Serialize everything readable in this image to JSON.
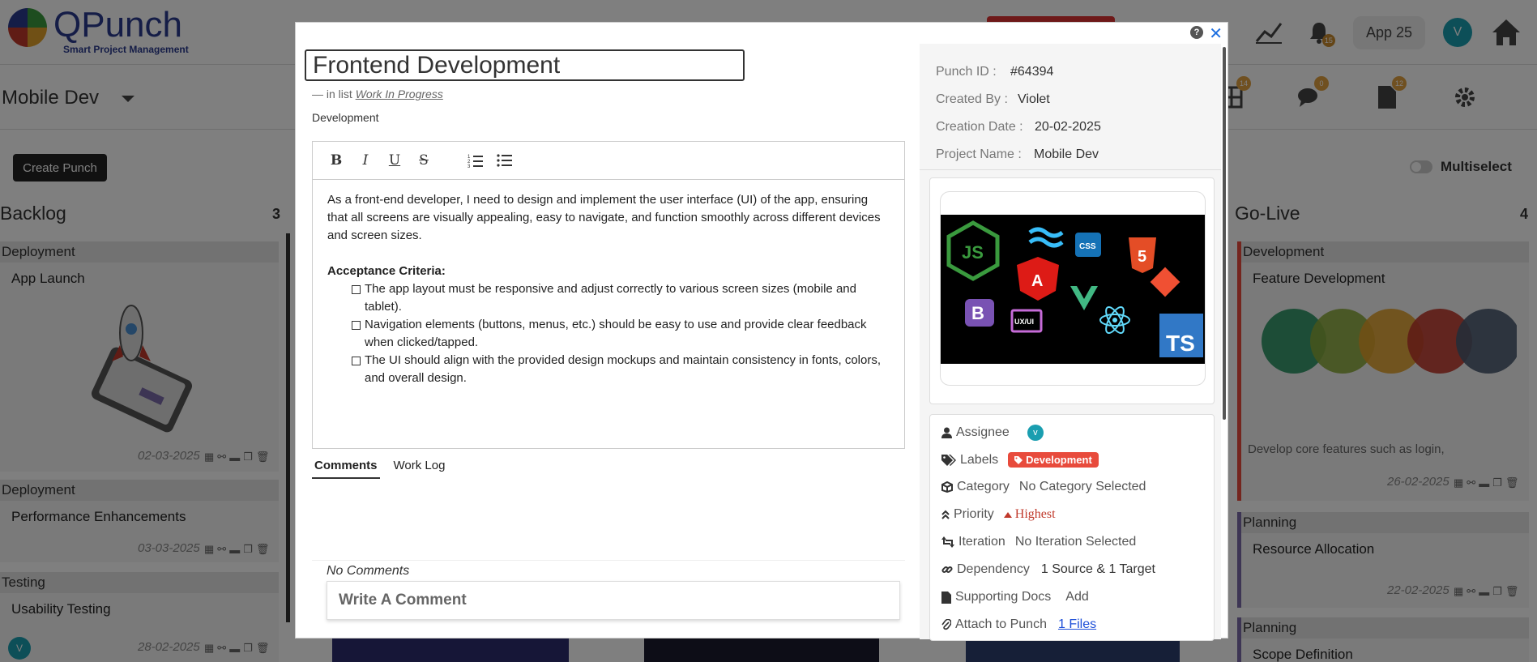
{
  "app": {
    "logo_text": "QPunch",
    "logo_sub": "Smart Project Management",
    "app_pill": "App 25",
    "avatar_initial": "V",
    "notif_count": "15"
  },
  "subbar": {
    "project_name": "Mobile Dev",
    "badges": [
      "14",
      "0",
      "12"
    ],
    "create_button": "Create Punch",
    "multiselect_label": "Multiselect"
  },
  "board": {
    "backlog": {
      "title": "Backlog",
      "count": "3",
      "cards": [
        {
          "group": "Deployment",
          "title": "App Launch",
          "date": "02-03-2025"
        },
        {
          "group": "Deployment",
          "title": "Performance Enhancements",
          "date": "03-03-2025"
        },
        {
          "group": "Testing",
          "title": "Usability Testing",
          "date": "28-02-2025",
          "avatar": "V"
        }
      ]
    },
    "golive": {
      "title": "Go-Live",
      "count": "4",
      "cards": [
        {
          "group": "Development",
          "title": "Feature Development",
          "snippet": "Develop core features such as login,",
          "date": "26-02-2025"
        },
        {
          "group": "Planning",
          "title": "Resource Allocation",
          "date": "22-02-2025"
        },
        {
          "group": "Planning",
          "title": "Scope Definition"
        }
      ]
    }
  },
  "modal": {
    "title": "Frontend Development",
    "in_list_prefix": "— in list",
    "in_list_name": "Work In Progress",
    "label_text": "Development",
    "help": "?",
    "close": "✕",
    "toolbar": {
      "bold": "B",
      "italic": "I",
      "underline": "U",
      "strike": "S",
      "ordered": "ordered-list-icon",
      "bullet": "bullet-list-icon"
    },
    "description": "As a front-end developer, I need to design and implement the user interface (UI) of the app, ensuring that all screens are visually appealing, easy to navigate, and function smoothly across different devices and screen sizes.",
    "acceptance_title": "Acceptance Criteria:",
    "acceptance": [
      "The app layout must be responsive and adjust correctly to various screen sizes (mobile and tablet).",
      "Navigation elements (buttons, menus, etc.) should be easy to use and provide clear feedback when clicked/tapped.",
      "The UI should align with the provided design mockups and maintain consistency in fonts, colors, and overall design."
    ],
    "tabs": [
      "Comments",
      "Work Log"
    ],
    "no_comments": "No Comments",
    "comment_placeholder": "Write A Comment"
  },
  "meta": {
    "punch_id_label": "Punch ID :",
    "punch_id": "#64394",
    "created_by_label": "Created By :",
    "created_by": "Violet",
    "creation_date_label": "Creation Date :",
    "creation_date": "20-02-2025",
    "project_name_label": "Project Name :",
    "project_name": "Mobile Dev"
  },
  "props": {
    "assignee_label": "Assignee",
    "assignee_initial": "v",
    "labels_label": "Labels",
    "labels_value": "Development",
    "category_label": "Category",
    "category_value": "No Category Selected",
    "priority_label": "Priority",
    "priority_value": "Highest",
    "iteration_label": "Iteration",
    "iteration_value": "No Iteration Selected",
    "dependency_label": "Dependency",
    "dependency_value": "1 Source & 1 Target",
    "docs_label": "Supporting Docs",
    "docs_value": "Add",
    "attach_label": "Attach to Punch",
    "attach_value": "1 Files"
  },
  "image_badges": {
    "css": "CSS",
    "html": "5",
    "uxui": "UX/UI",
    "ts": "TS",
    "b": "B",
    "js": "JS"
  },
  "colors": {
    "accent": "#1e6fe0",
    "label_chip": "#e84b3c",
    "priority": "#c0392b",
    "avatar": "#1a9eb0"
  }
}
